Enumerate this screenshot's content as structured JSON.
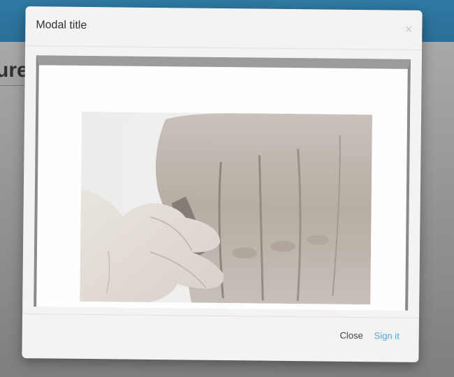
{
  "background": {
    "heading_fragment": "ure",
    "topbar_color": "#2f7aa3"
  },
  "modal": {
    "title": "Modal title",
    "close_icon": "close-icon",
    "body": {
      "image_subject": "black and white photo of a baby hand holding an adult hand"
    },
    "footer": {
      "close_label": "Close",
      "primary_label": "Sign it",
      "primary_color": "#49a9da"
    }
  }
}
